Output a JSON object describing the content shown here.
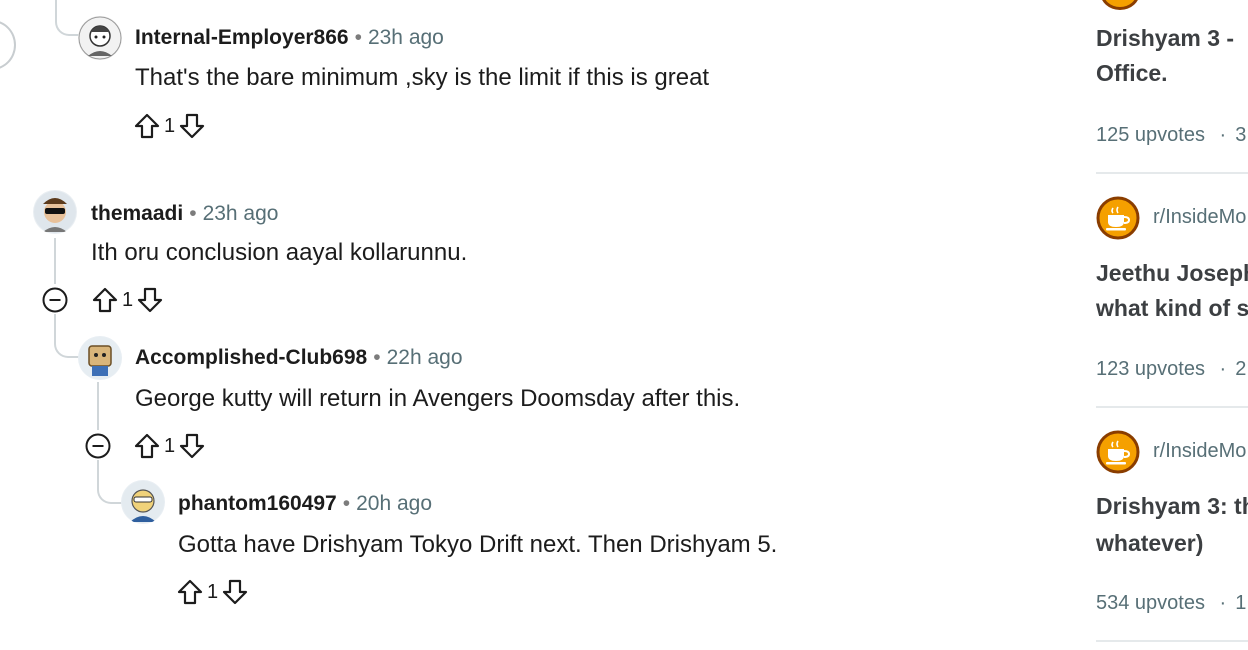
{
  "comments": [
    {
      "user": "Internal-Employer866",
      "sep": "•",
      "time": "23h ago",
      "text": "That's the bare minimum ,sky is the limit if this is great",
      "score": "1"
    },
    {
      "user": "themaadi",
      "sep": "•",
      "time": "23h ago",
      "text": "Ith oru conclusion aayal kollarunnu.",
      "score": "1"
    },
    {
      "user": "Accomplished-Club698",
      "sep": "•",
      "time": "22h ago",
      "text": "George kutty will return in Avengers Doomsday after this.",
      "score": "1"
    },
    {
      "user": "phantom160497",
      "sep": "•",
      "time": "20h ago",
      "text": "Gotta have Drishyam Tokyo Drift next. Then Drishyam 5.",
      "score": "1"
    }
  ],
  "sidebar": {
    "posts": [
      {
        "title_line1": "Drishyam 3 -",
        "title_line2": "Office.",
        "meta": "125 upvotes",
        "meta_sep": "·",
        "meta_cut": "3"
      },
      {
        "subreddit": "r/InsideMo",
        "title_line1": "Jeethu Joseph",
        "title_line2": "what kind of s",
        "meta": "123 upvotes",
        "meta_sep": "·",
        "meta_cut": "2"
      },
      {
        "subreddit": "r/InsideMo",
        "title_line1": "Drishyam 3: th",
        "title_line2": "whatever)",
        "meta": "534 upvotes",
        "meta_sep": "·",
        "meta_cut": "1"
      }
    ]
  },
  "colors": {
    "thread_line": "#d0d6d9",
    "cup_bg": "#f5a000",
    "cup_ring": "#8a3d00"
  }
}
